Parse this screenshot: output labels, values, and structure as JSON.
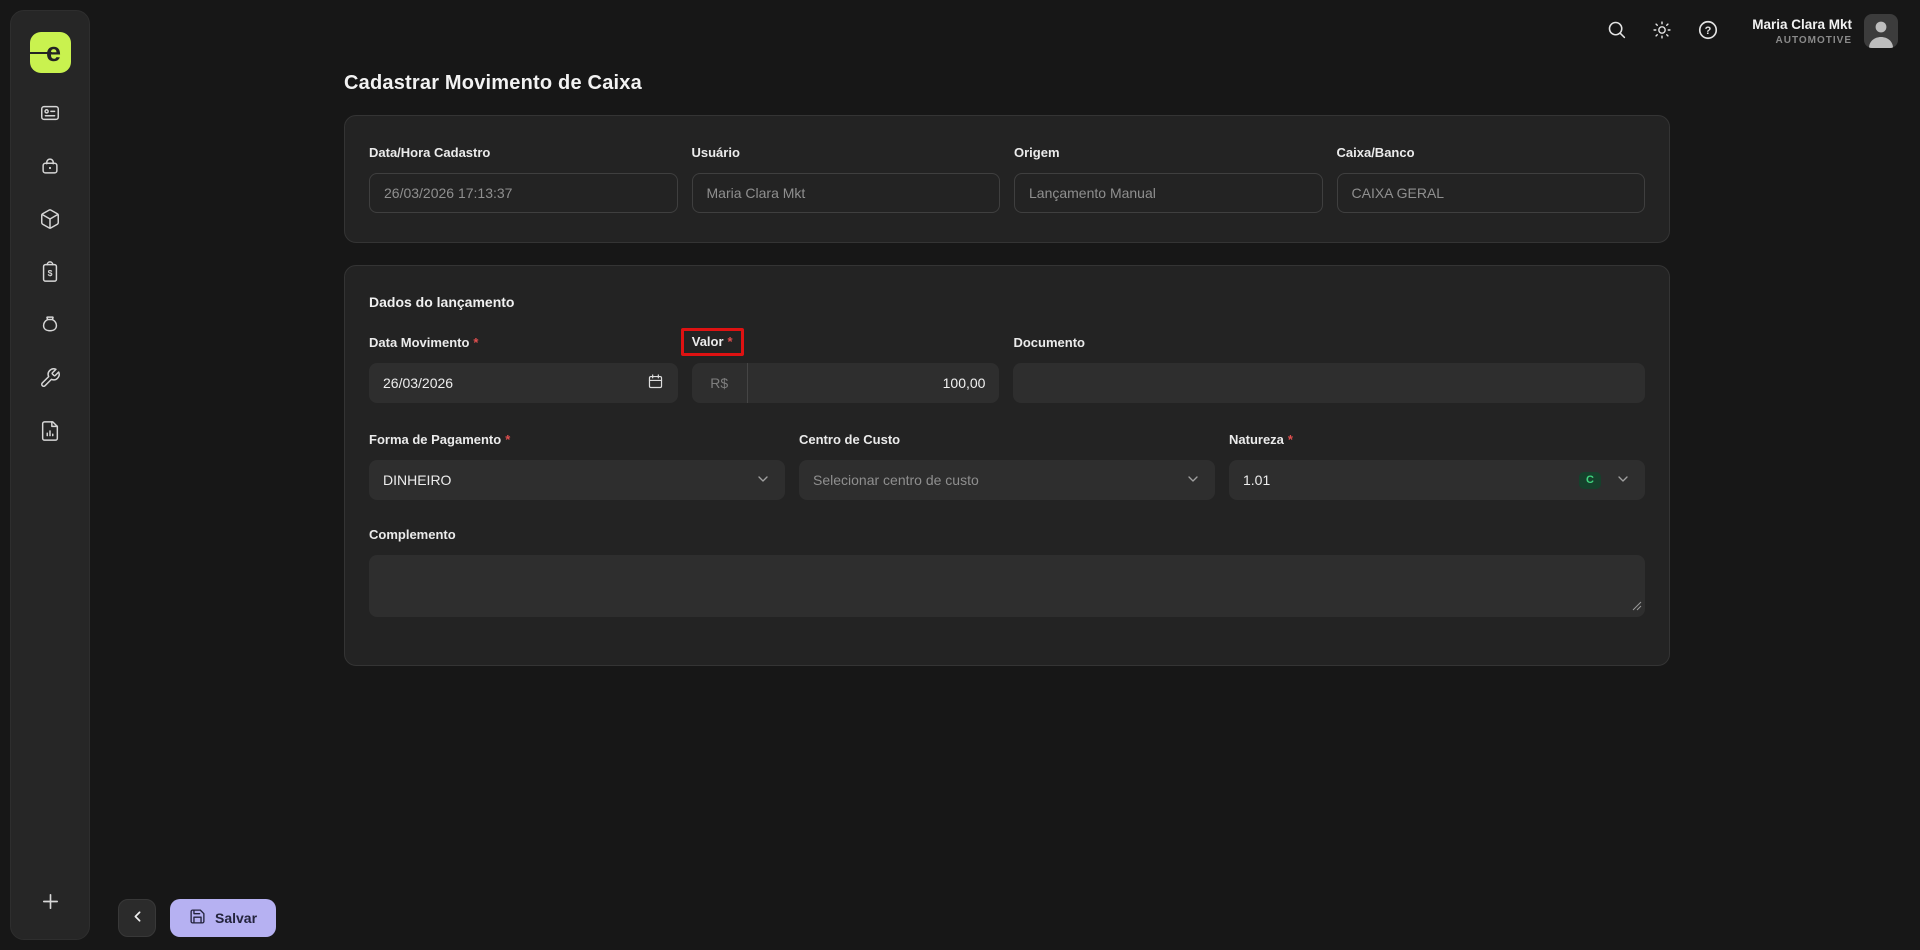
{
  "sidebar": {
    "logo_letter": "e",
    "icons": [
      "id-card",
      "basket",
      "package",
      "invoice-clipboard",
      "money-bag",
      "wrench",
      "report-file"
    ],
    "add_button": "plus"
  },
  "header": {
    "icons": [
      "search",
      "theme-sun",
      "help-circle"
    ],
    "user_name": "Maria Clara Mkt",
    "user_org": "AUTOMOTIVE"
  },
  "page_title": "Cadastrar Movimento de Caixa",
  "required_mark": "*",
  "info_card": {
    "fields": [
      {
        "label": "Data/Hora Cadastro",
        "value": "26/03/2026 17:13:37"
      },
      {
        "label": "Usuário",
        "value": "Maria Clara Mkt"
      },
      {
        "label": "Origem",
        "value": "Lançamento Manual"
      },
      {
        "label": "Caixa/Banco",
        "value": "CAIXA GERAL"
      }
    ]
  },
  "entry_card": {
    "title": "Dados do lançamento",
    "data_movimento": {
      "label": "Data Movimento",
      "value": "26/03/2026"
    },
    "valor": {
      "label": "Valor",
      "prefix": "R$",
      "value": "100,00",
      "highlighted": true
    },
    "documento": {
      "label": "Documento",
      "value": ""
    },
    "forma_pagamento": {
      "label": "Forma de Pagamento",
      "value": "DINHEIRO"
    },
    "centro_custo": {
      "label": "Centro de Custo",
      "placeholder": "Selecionar centro de custo"
    },
    "natureza": {
      "label": "Natureza",
      "value": "1.01",
      "badge": "C"
    },
    "complemento": {
      "label": "Complemento",
      "value": ""
    }
  },
  "footer": {
    "save_label": "Salvar"
  },
  "colors": {
    "accent_lime": "#c9f24f",
    "save_button": "#b6b1f2",
    "highlight_red": "#de1212",
    "badge_green_text": "#40d47e",
    "badge_green_bg": "#16412c",
    "card_bg": "#232323",
    "page_bg": "#171717"
  }
}
